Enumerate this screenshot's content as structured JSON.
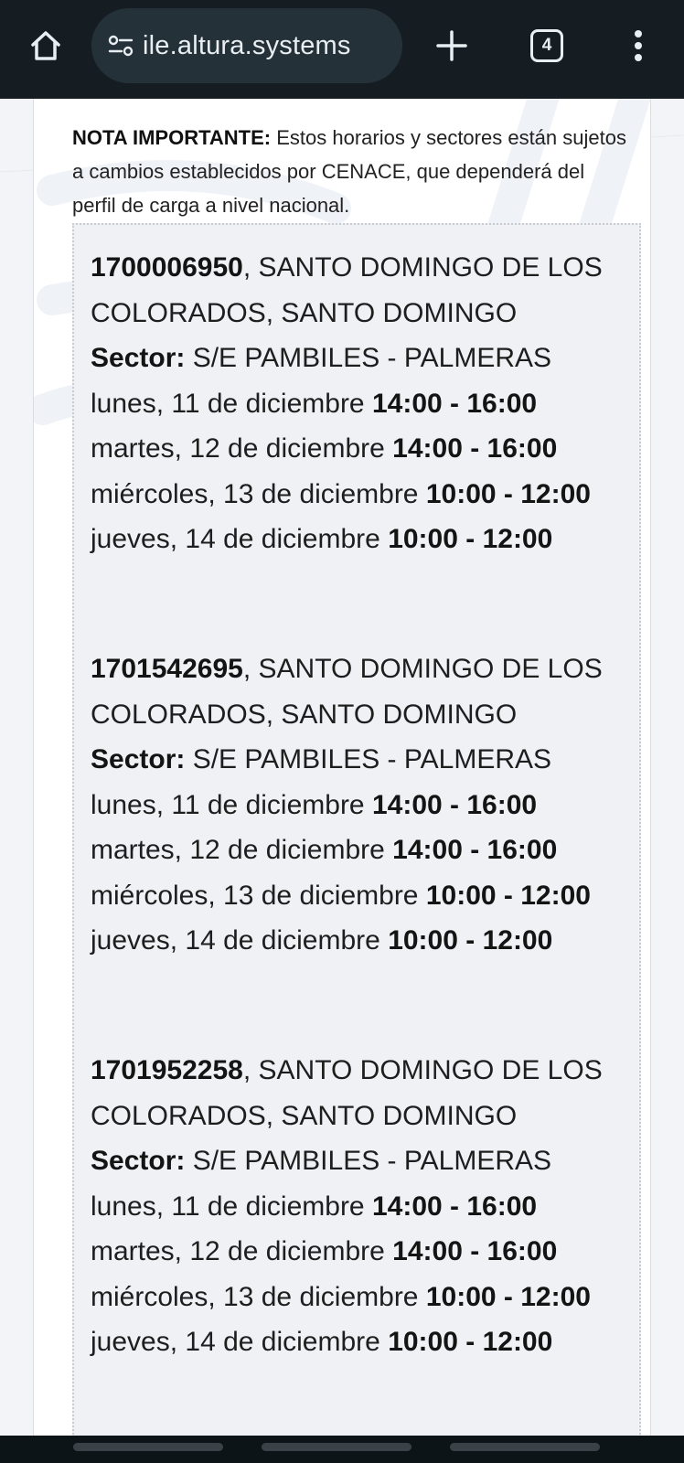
{
  "browser": {
    "url": "ile.altura.systems",
    "tab_count": "4"
  },
  "note": {
    "label": "NOTA IMPORTANTE:",
    "text": " Estos horarios y sectores están sujetos a cambios establecidos por CENACE, que dependerá del perfil de carga a nivel nacional."
  },
  "entries": [
    {
      "id": "1700006950",
      "location": ", SANTO DOMINGO DE LOS COLORADOS, SANTO DOMINGO",
      "sector_label": "Sector:",
      "sector": " S/E PAMBILES - PALMERAS",
      "days": [
        {
          "day": "lunes, 11 de diciembre ",
          "time": "14:00 - 16:00"
        },
        {
          "day": "martes, 12 de diciembre ",
          "time": "14:00 - 16:00"
        },
        {
          "day": "miércoles, 13 de diciembre ",
          "time": "10:00 - 12:00"
        },
        {
          "day": "jueves, 14 de diciembre ",
          "time": "10:00 - 12:00"
        }
      ]
    },
    {
      "id": "1701542695",
      "location": ", SANTO DOMINGO DE LOS COLORADOS, SANTO DOMINGO",
      "sector_label": "Sector:",
      "sector": " S/E PAMBILES - PALMERAS",
      "days": [
        {
          "day": "lunes, 11 de diciembre ",
          "time": "14:00 - 16:00"
        },
        {
          "day": "martes, 12 de diciembre ",
          "time": "14:00 - 16:00"
        },
        {
          "day": "miércoles, 13 de diciembre ",
          "time": "10:00 - 12:00"
        },
        {
          "day": "jueves, 14 de diciembre ",
          "time": "10:00 - 12:00"
        }
      ]
    },
    {
      "id": "1701952258",
      "location": ", SANTO DOMINGO DE LOS COLORADOS, SANTO DOMINGO",
      "sector_label": "Sector:",
      "sector": " S/E PAMBILES - PALMERAS",
      "days": [
        {
          "day": "lunes, 11 de diciembre ",
          "time": "14:00 - 16:00"
        },
        {
          "day": "martes, 12 de diciembre ",
          "time": "14:00 - 16:00"
        },
        {
          "day": "miércoles, 13 de diciembre ",
          "time": "10:00 - 12:00"
        },
        {
          "day": "jueves, 14 de diciembre ",
          "time": "10:00 - 12:00"
        }
      ]
    }
  ],
  "icons": {
    "home": "home-icon",
    "site_settings": "site-settings-icon",
    "new_tab": "plus-icon",
    "tabs": "tab-switcher-icon",
    "menu": "more-vert-icon"
  }
}
